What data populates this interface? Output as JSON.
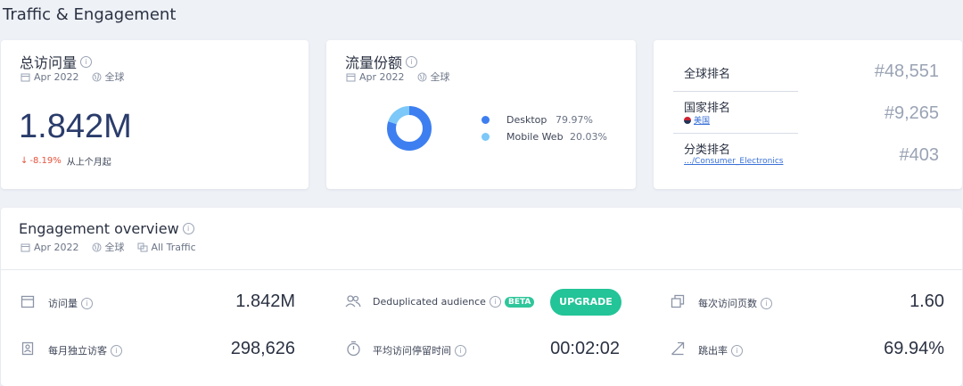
{
  "page": {
    "title": "Traffic & Engagement"
  },
  "visits_card": {
    "title": "总访问量",
    "date": "Apr 2022",
    "region": "全球",
    "value": "1.842M",
    "change": "-8.19%",
    "change_label": "从上个月起",
    "change_color": "#e5533d"
  },
  "share_card": {
    "title": "流量份额",
    "date": "Apr 2022",
    "region": "全球",
    "legend": [
      {
        "label": "Desktop",
        "value": "79.97%",
        "color": "#3d7ff0"
      },
      {
        "label": "Mobile Web",
        "value": "20.03%",
        "color": "#7cc8f8"
      }
    ]
  },
  "chart_data": {
    "type": "pie",
    "categories": [
      "Desktop",
      "Mobile Web"
    ],
    "values": [
      79.97,
      20.03
    ],
    "colors": [
      "#3d7ff0",
      "#7cc8f8"
    ]
  },
  "rank_card": {
    "global_label": "全球排名",
    "global_value": "#48,551",
    "country_label": "国家排名",
    "country_name": "美国",
    "country_value": "#9,265",
    "category_label": "分类排名",
    "category_path": "…/Consumer_Electronics",
    "category_value": "#403"
  },
  "engagement": {
    "title": "Engagement overview",
    "date": "Apr 2022",
    "region": "全球",
    "traffic": "All Traffic",
    "visits_label": "访问量",
    "visits_value": "1.842M",
    "unique_label": "每月独立访客",
    "unique_value": "298,626",
    "dedup_label": "Deduplicated audience",
    "beta_label": "BETA",
    "upgrade_label": "UPGRADE",
    "duration_label": "平均访问停留时间",
    "duration_value": "00:02:02",
    "pages_label": "每次访问页数",
    "pages_value": "1.60",
    "bounce_label": "跳出率",
    "bounce_value": "69.94%"
  }
}
